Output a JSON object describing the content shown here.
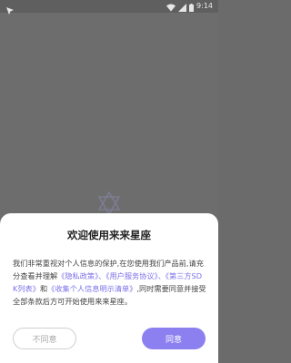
{
  "status_bar": {
    "time": "9:14",
    "left_icon": "navigation-arrow-icon",
    "wifi_icon": "wifi-icon",
    "signal_icon": "signal-icon",
    "battery_icon": "battery-icon"
  },
  "background": {
    "logo_icon": "star-logo-icon"
  },
  "dialog": {
    "title": "欢迎使用来来星座",
    "body_intro": "我们非常重视对个人信息的保护,在您使用我们产品前,请充分查看并理解",
    "link_privacy": "《隐私政策》",
    "sep1": "、",
    "link_user_agreement": "《用户服务协议》",
    "sep2": "、",
    "link_sdk_list": "《第三方SDK列表》",
    "sep3": "和",
    "link_info_collection": "《收集个人信息明示清单》",
    "body_outro": ",同时需要同意并接受全部条款后方可开始使用来来星座。",
    "disagree_label": "不同意",
    "agree_label": "同意"
  },
  "colors": {
    "overlay_background": "#6d6d6d",
    "link": "#7b72e9",
    "agree_button": "#8c80f0"
  }
}
